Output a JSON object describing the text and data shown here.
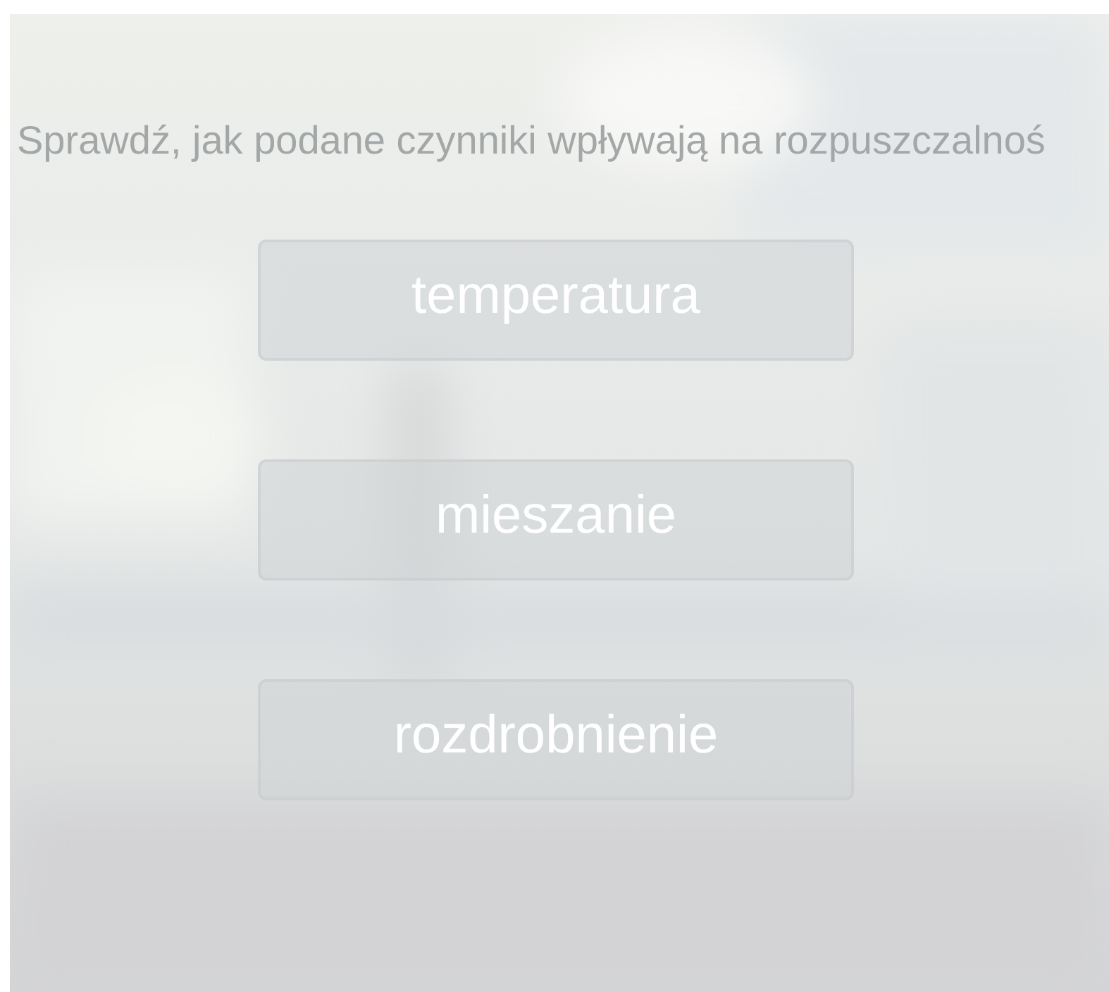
{
  "title": "Sprawdź, jak podane czynniki wpływają na rozpuszczalnoś",
  "options": [
    {
      "label": "temperatura"
    },
    {
      "label": "mieszanie"
    },
    {
      "label": "rozdrobnienie"
    }
  ]
}
